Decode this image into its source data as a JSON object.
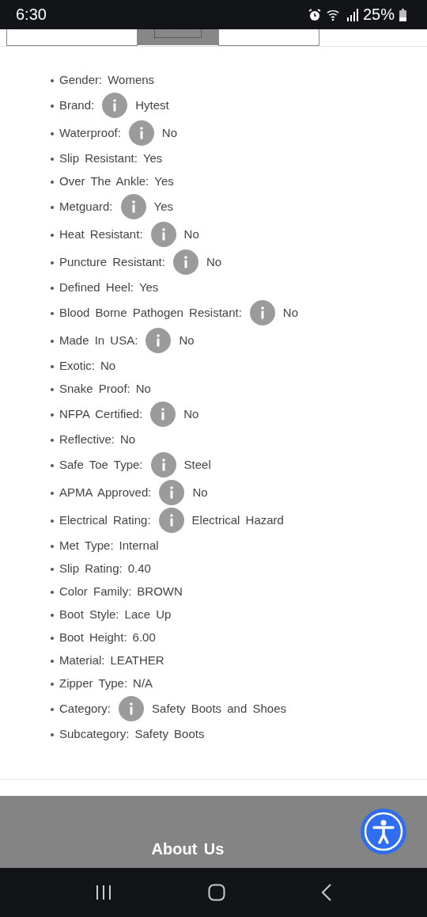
{
  "status_bar": {
    "time": "6:30",
    "battery": "25%"
  },
  "tabs": [
    {
      "selected": false
    },
    {
      "selected": true
    },
    {
      "selected": false
    }
  ],
  "specs": [
    {
      "label": "Gender:",
      "value": "Womens",
      "info": false
    },
    {
      "label": "Brand:",
      "value": "Hytest",
      "info": true
    },
    {
      "label": "Waterproof:",
      "value": "No",
      "info": true
    },
    {
      "label": "Slip Resistant:",
      "value": "Yes",
      "info": false
    },
    {
      "label": "Over The Ankle:",
      "value": "Yes",
      "info": false
    },
    {
      "label": "Metguard:",
      "value": "Yes",
      "info": true
    },
    {
      "label": "Heat Resistant:",
      "value": "No",
      "info": true
    },
    {
      "label": "Puncture Resistant:",
      "value": "No",
      "info": true
    },
    {
      "label": "Defined Heel:",
      "value": "Yes",
      "info": false
    },
    {
      "label": "Blood Borne Pathogen Resistant:",
      "value": "No",
      "info": true
    },
    {
      "label": "Made In USA:",
      "value": "No",
      "info": true
    },
    {
      "label": "Exotic:",
      "value": "No",
      "info": false
    },
    {
      "label": "Snake Proof:",
      "value": "No",
      "info": false
    },
    {
      "label": "NFPA Certified:",
      "value": "No",
      "info": true
    },
    {
      "label": "Reflective:",
      "value": "No",
      "info": false
    },
    {
      "label": "Safe Toe Type:",
      "value": "Steel",
      "info": true
    },
    {
      "label": "APMA Approved:",
      "value": "No",
      "info": true
    },
    {
      "label": "Electrical Rating:",
      "value": "Electrical Hazard",
      "info": true
    },
    {
      "label": "Met Type:",
      "value": "Internal",
      "info": false
    },
    {
      "label": "Slip Rating:",
      "value": "0.40",
      "info": false
    },
    {
      "label": "Color Family:",
      "value": "BROWN",
      "info": false
    },
    {
      "label": "Boot Style:",
      "value": "Lace Up",
      "info": false
    },
    {
      "label": "Boot Height:",
      "value": "6.00",
      "info": false
    },
    {
      "label": "Material:",
      "value": "LEATHER",
      "info": false
    },
    {
      "label": "Zipper Type:",
      "value": "N/A",
      "info": false
    },
    {
      "label": "Category:",
      "value": "Safety Boots and Shoes",
      "info": true
    },
    {
      "label": "Subcategory:",
      "value": "Safety Boots",
      "info": false
    }
  ],
  "footer": {
    "heading": "About Us"
  }
}
